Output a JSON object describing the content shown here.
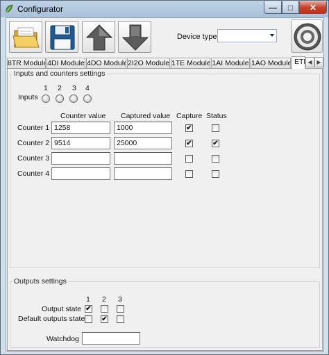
{
  "window": {
    "title": "Configurator"
  },
  "toolbar": {
    "buttons": [
      {
        "name": "open-folder-icon"
      },
      {
        "name": "floppy-save-icon"
      },
      {
        "name": "arrow-up-icon"
      },
      {
        "name": "arrow-down-icon"
      }
    ],
    "device_type_label": "Device type:",
    "device_type_value": ""
  },
  "tabs": [
    "8TR Module",
    "4DI Module",
    "4DO Module",
    "2I2O Module",
    "1TE Module",
    "1AI Module",
    "1AO Module",
    "ETH"
  ],
  "active_tab": 7,
  "inputs_group": {
    "title": "Inputs and counters settings",
    "inputs_label": "Inputs",
    "input_numbers": [
      "1",
      "2",
      "3",
      "4"
    ],
    "headers": {
      "counter_value": "Counter value",
      "captured_value": "Captured value",
      "capture": "Capture",
      "status": "Status"
    },
    "counters": [
      {
        "label": "Counter 1",
        "counter_value": "1258",
        "captured_value": "1000",
        "capture": true,
        "status": false
      },
      {
        "label": "Counter 2",
        "counter_value": "9514",
        "captured_value": "25000",
        "capture": true,
        "status": true
      },
      {
        "label": "Counter 3",
        "counter_value": "",
        "captured_value": "",
        "capture": false,
        "status": false
      },
      {
        "label": "Counter 4",
        "counter_value": "",
        "captured_value": "",
        "capture": false,
        "status": false
      }
    ]
  },
  "outputs_group": {
    "title": "Outputs settings",
    "output_numbers": [
      "1",
      "2",
      "3"
    ],
    "output_state_label": "Output state",
    "output_state": [
      true,
      false,
      false
    ],
    "default_state_label": "Default outputs state",
    "default_state": [
      false,
      true,
      false
    ],
    "watchdog_label": "Watchdog",
    "watchdog_value": ""
  },
  "colors": {
    "accent_titlebar": "#bfd2e6",
    "close_button": "#c7422c"
  }
}
